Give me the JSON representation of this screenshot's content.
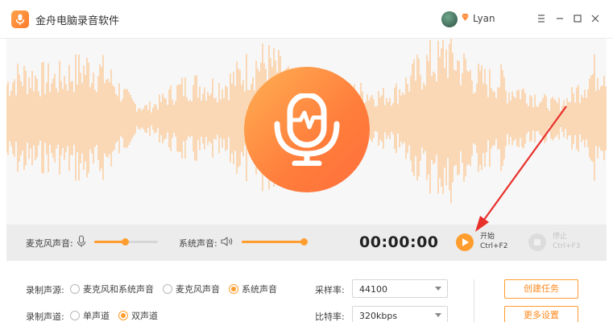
{
  "app": {
    "title": "金舟电脑录音软件",
    "username": "Lyan"
  },
  "colors": {
    "accent": "#ff9d2f",
    "wave": "#fcc893",
    "mic_gradient_start": "#ffb054",
    "mic_gradient_end": "#ff6f3c"
  },
  "window_controls": [
    "menu-icon",
    "minimize-icon",
    "maximize-icon",
    "close-icon"
  ],
  "control": {
    "mic_volume_label": "麦克风声音:",
    "mic_volume_level": 0.48,
    "system_volume_label": "系统声音:",
    "system_volume_level": 1.0,
    "timer": "00:00:00",
    "start_label": "开始",
    "start_shortcut": "Ctrl+F2",
    "stop_label": "停止",
    "stop_shortcut": "Ctrl+F3"
  },
  "settings": {
    "source_label": "录制声源:",
    "source_options": [
      "麦克风和系统声音",
      "麦克风声音",
      "系统声音"
    ],
    "source_selected": "系统声音",
    "channel_label": "录制声道:",
    "channel_options": [
      "单声道",
      "双声道"
    ],
    "channel_selected": "双声道",
    "sample_rate_label": "采样率:",
    "sample_rate_value": "44100",
    "bitrate_label": "比特率:",
    "bitrate_value": "320kbps",
    "create_task_label": "创建任务",
    "more_settings_label": "更多设置"
  }
}
